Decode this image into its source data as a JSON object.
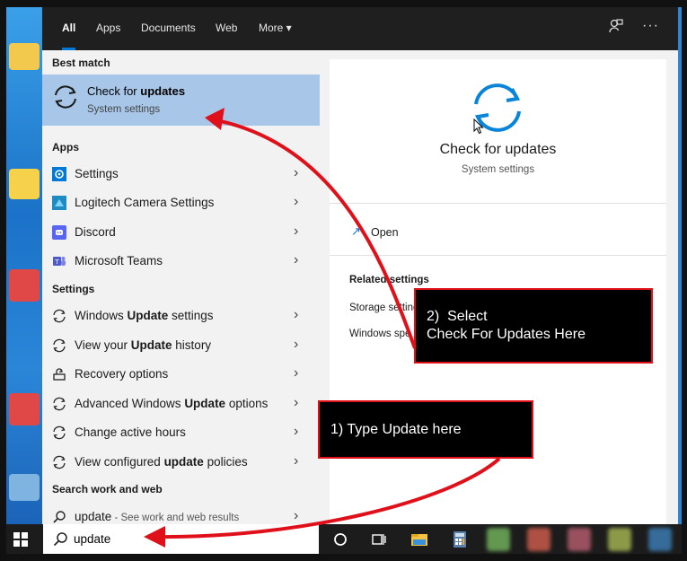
{
  "tabs": [
    {
      "label": "All",
      "active": true
    },
    {
      "label": "Apps"
    },
    {
      "label": "Documents"
    },
    {
      "label": "Web"
    },
    {
      "label": "More ▾"
    }
  ],
  "sections": {
    "best_match": "Best match",
    "apps": "Apps",
    "settings": "Settings",
    "search_web": "Search work and web"
  },
  "best_match": {
    "title_plain": "Check for ",
    "title_bold": "updates",
    "subtitle": "System settings"
  },
  "apps": [
    {
      "label": "Settings"
    },
    {
      "label": "Logitech Camera Settings"
    },
    {
      "label": "Discord"
    },
    {
      "label": "Microsoft Teams"
    }
  ],
  "settings": [
    {
      "pre": "Windows ",
      "bold": "Update",
      "post": " settings"
    },
    {
      "pre": "View your ",
      "bold": "Update",
      "post": " history"
    },
    {
      "pre": "Recovery options",
      "bold": "",
      "post": ""
    },
    {
      "pre": "Advanced Windows ",
      "bold": "Update",
      "post": " options"
    },
    {
      "pre": "Change active hours",
      "bold": "",
      "post": ""
    },
    {
      "pre": "View configured ",
      "bold": "update",
      "post": " policies"
    }
  ],
  "web_result": {
    "query": "update",
    "suffix": " - See work and web results"
  },
  "preview": {
    "title": "Check for updates",
    "subtitle": "System settings",
    "open": "Open",
    "related": "Related settings",
    "links": [
      "Storage setting",
      "Windows spe"
    ]
  },
  "search_box": {
    "value": "update"
  },
  "callouts": {
    "step2": "2)  Select\nCheck For Updates Here",
    "step1": "1) Type Update here"
  },
  "colors": {
    "accent": "#0078d7",
    "highlight": "#a8c7e8",
    "annotation": "#e0101a"
  }
}
